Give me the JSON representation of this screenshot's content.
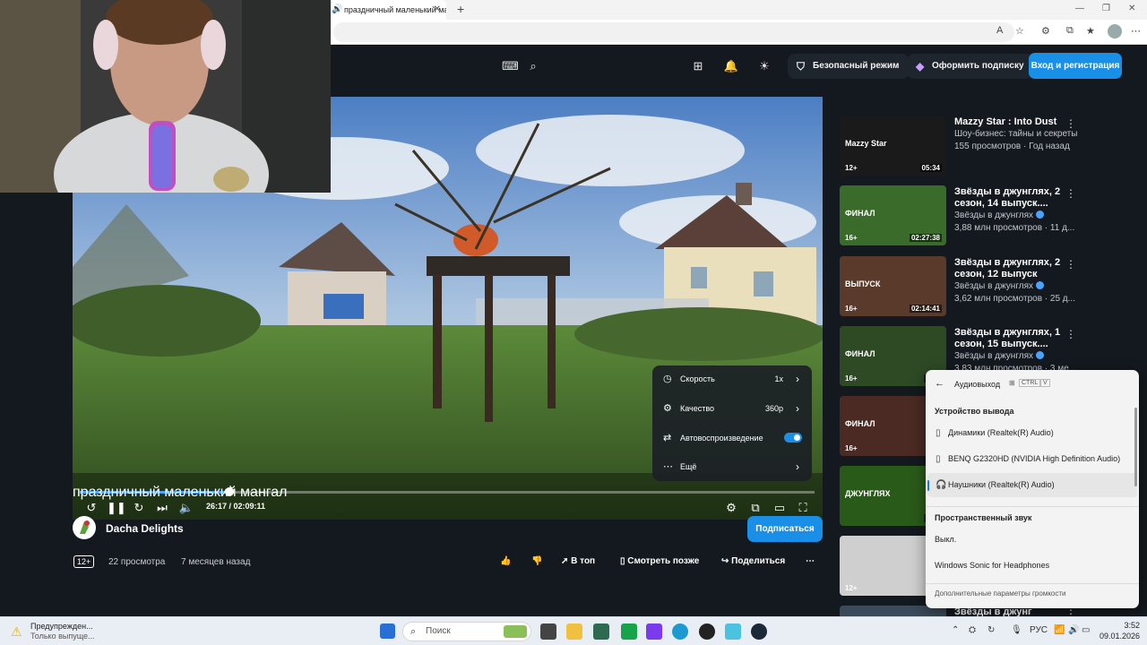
{
  "browser": {
    "tab_title": "праздничный маленький ма",
    "tab_speaker_icon": "speaker-icon",
    "new_tab": "+"
  },
  "header": {
    "safe_mode": "Безопасный режим",
    "subscribe_offer": "Оформить подписку",
    "login": "Вход и регистрация"
  },
  "player": {
    "time": "26:17 / 02:09:11",
    "progress_fraction": 0.2034,
    "menu": {
      "speed_label": "Скорость",
      "speed_value": "1x",
      "quality_label": "Качество",
      "quality_value": "360p",
      "autoplay_label": "Автовоспроизведение",
      "autoplay_on": true,
      "more_label": "Ещё"
    }
  },
  "video": {
    "title": "праздничный маленький мангал",
    "channel": "Dacha Delights",
    "subscribe": "Подписаться",
    "age": "12+",
    "views": "22 просмотра",
    "date": "7 месяцев назад",
    "actions": {
      "top": "В топ",
      "watch_later": "Смотреть позже",
      "share": "Поделиться"
    }
  },
  "recommendations": [
    {
      "title": "Mazzy Star : Into Dust",
      "channel": "Шоу-бизнес: тайны и секреты",
      "stats": "155 просмотров · Год назад",
      "age": "12+",
      "duration": "05:34",
      "thumb_label": "Mazzy Star",
      "verified": false
    },
    {
      "title": "Звёзды в джунглях, 2 сезон, 14 выпуск....",
      "channel": "Звёзды в джунглях",
      "stats": "3,88 млн просмотров · 11 д...",
      "age": "16+",
      "duration": "02:27:38",
      "thumb_label": "ФИНАЛ",
      "verified": true
    },
    {
      "title": "Звёзды в джунглях, 2 сезон, 12 выпуск",
      "channel": "Звёзды в джунглях",
      "stats": "3,62 млн просмотров · 25 д...",
      "age": "16+",
      "duration": "02:14:41",
      "thumb_label": "ВЫПУСК",
      "verified": true
    },
    {
      "title": "Звёзды в джунглях, 1 сезон, 15 выпуск....",
      "channel": "Звёзды в джунглях",
      "stats": "3,83 млн просмотров · 3 ме...",
      "age": "16+",
      "duration": "02:1",
      "thumb_label": "ФИНАЛ",
      "verified": true
    },
    {
      "title": "",
      "channel": "",
      "stats": "",
      "age": "16+",
      "duration": "",
      "thumb_label": "ФИНАЛ",
      "verified": false
    },
    {
      "title": "",
      "channel": "",
      "stats": "",
      "age": "",
      "duration": "02:2",
      "thumb_label": "ДЖУНГЛЯХ",
      "verified": false
    },
    {
      "title": "",
      "channel": "",
      "stats": "",
      "age": "12+",
      "duration": "",
      "thumb_label": "",
      "verified": false
    },
    {
      "title": "Звёзды в джунг",
      "channel": "",
      "stats": "",
      "age": "",
      "duration": "",
      "thumb_label": "",
      "verified": false
    }
  ],
  "audio_flyout": {
    "title": "Аудиовыход",
    "shortcut": [
      "CTRL",
      "V"
    ],
    "output_section": "Устройство вывода",
    "devices": [
      {
        "name": "Динамики (Realtek(R) Audio)",
        "icon": "speaker-device-icon",
        "selected": false
      },
      {
        "name": "BENQ G2320HD (NVIDIA High Definition Audio)",
        "icon": "monitor-speaker-icon",
        "selected": false
      },
      {
        "name": "Наушники (Realtek(R) Audio)",
        "icon": "headphones-icon",
        "selected": true
      }
    ],
    "spatial_section": "Пространственный звук",
    "spatial_options": [
      "Выкл.",
      "Windows Sonic for Headphones"
    ],
    "footer": "Дополнительные параметры громкости"
  },
  "taskbar": {
    "notification_title": "Предупрежден...",
    "notification_sub": "Только выпуще...",
    "search_placeholder": "Поиск",
    "language": "РУС",
    "time": "3:52",
    "date": "09.01.2026"
  }
}
